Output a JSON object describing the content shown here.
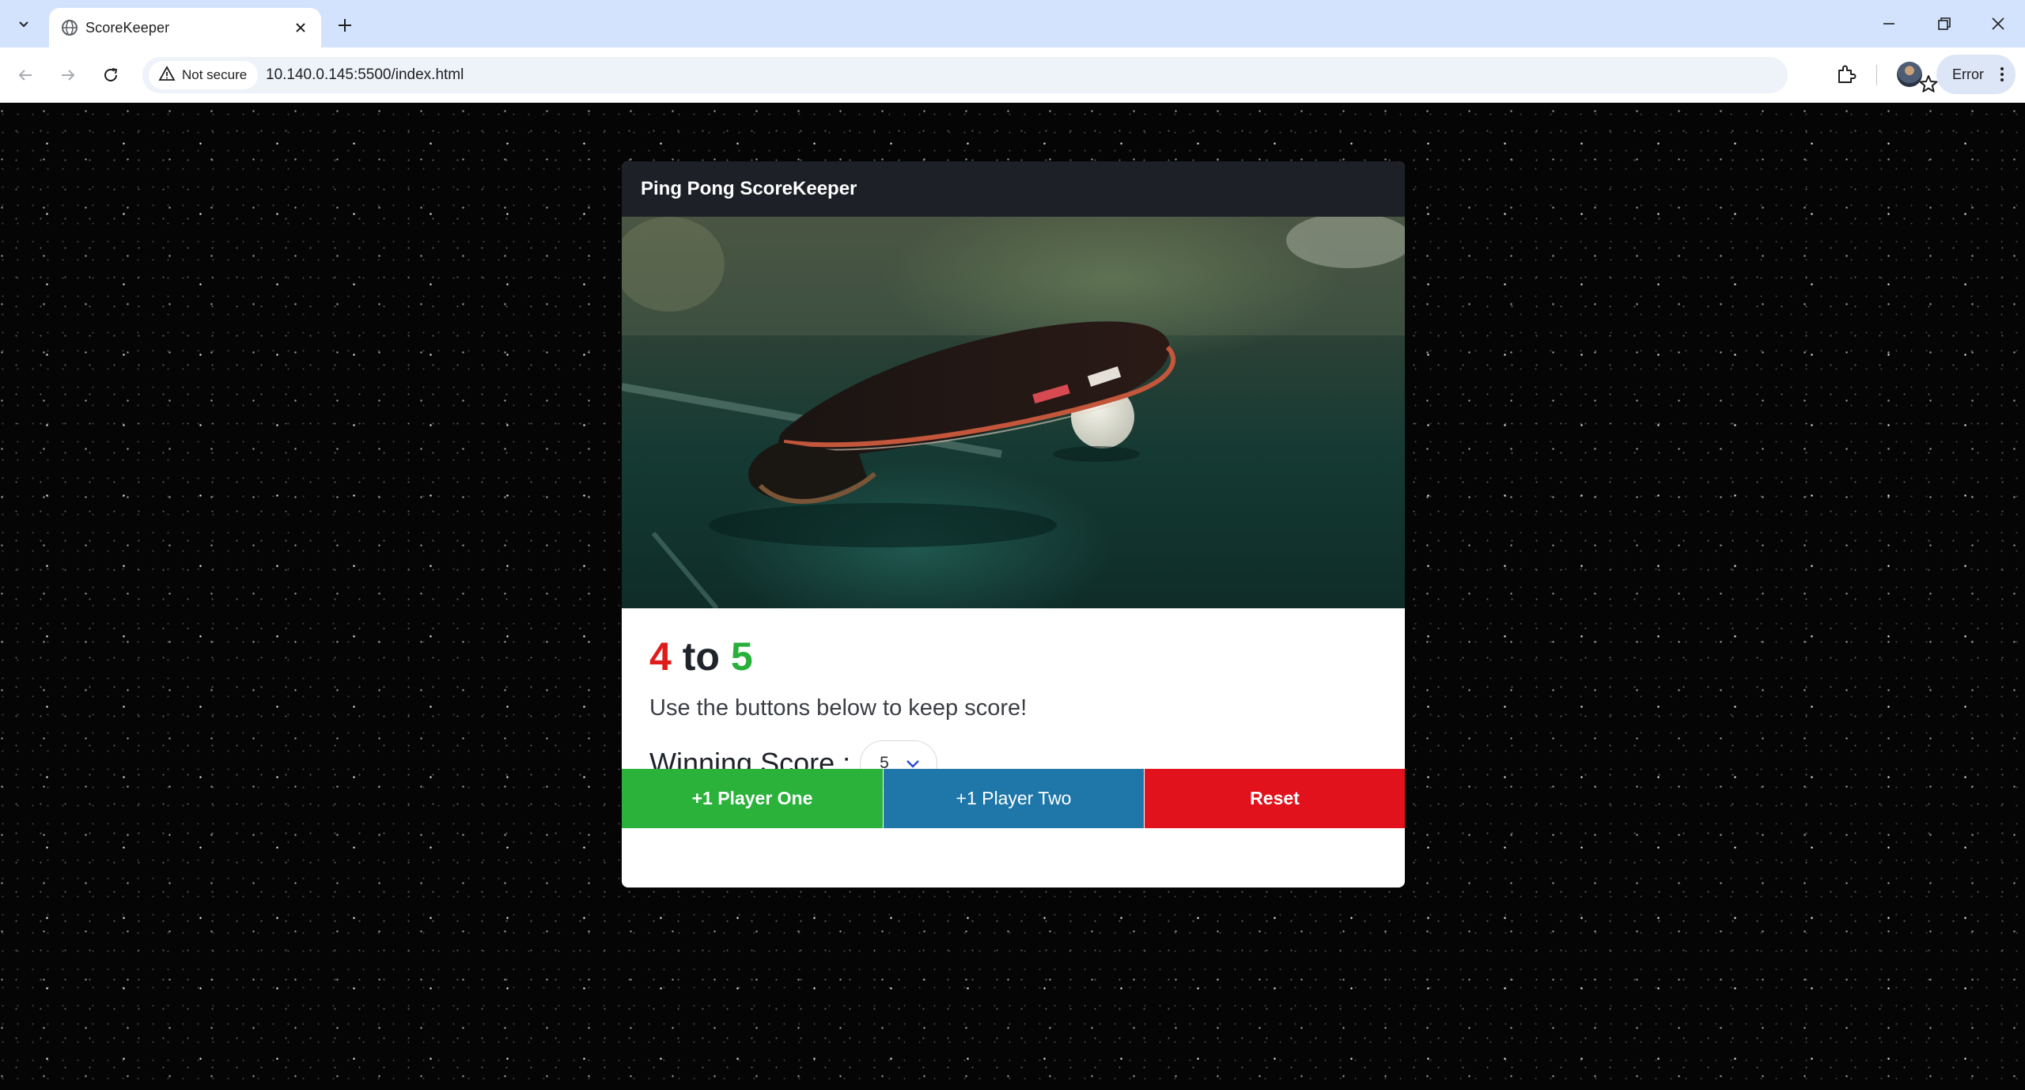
{
  "browser": {
    "tab_title": "ScoreKeeper",
    "security_label": "Not secure",
    "url": "10.140.0.145:5500/index.html",
    "profile_status": "Error"
  },
  "app": {
    "title": "Ping Pong ScoreKeeper",
    "image_alt": "ping pong paddle and ball on table",
    "score": {
      "player_one": "4",
      "separator": "to",
      "player_two": "5"
    },
    "hint": "Use the buttons below to keep score!",
    "winning_score": {
      "label": "Winning Score :",
      "selected": "5"
    },
    "buttons": {
      "player_one": "+1 Player One",
      "player_two": "+1 Player Two",
      "reset": "Reset"
    },
    "colors": {
      "player_one": "#e01b1b",
      "player_two": "#28b03a",
      "button_one": "#2ab23b",
      "button_two": "#1e77a8",
      "button_reset": "#e1121b",
      "header": "#1d2127"
    }
  }
}
